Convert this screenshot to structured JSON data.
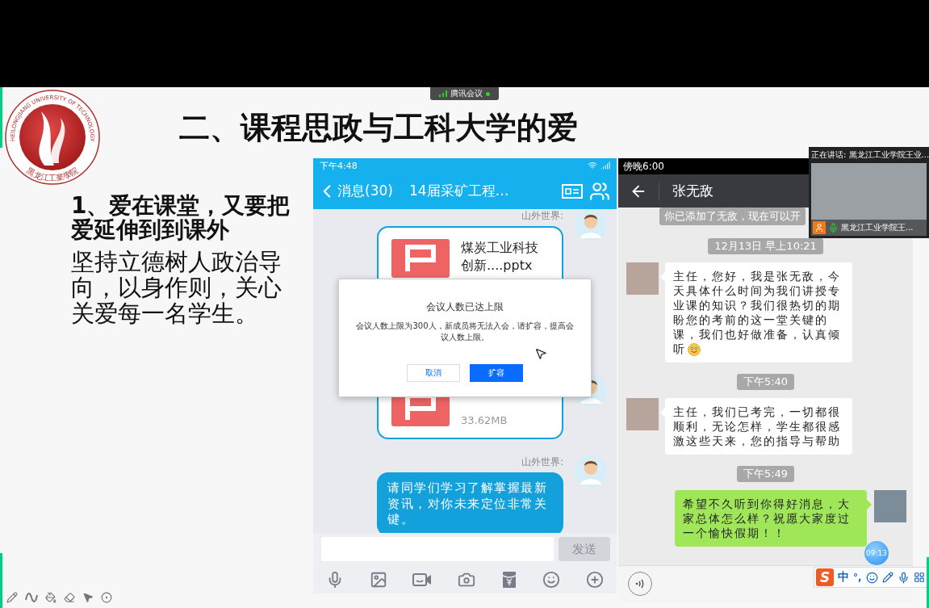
{
  "meeting_badge": {
    "label": "腾讯会议"
  },
  "slide": {
    "logo": {
      "ring_text": "HEILONGJIANG UNIVERSITY OF TECHNOLOGY",
      "seal_text": "黑龙江工業學院"
    },
    "title": "二、课程思政与工科大学的爱",
    "heading": "1、爱在课堂，又要把爱延伸到到课外",
    "body": "坚持立德树人政治导向，以身作则，关心关爱每一名学生。"
  },
  "qq_chat": {
    "status_time": "下午4:48",
    "back_label": "消息(30)",
    "title": "14届采矿工程…",
    "messages": [
      {
        "kind": "file",
        "sender": "山外世界:",
        "name": "煤炭工业科技创新....pptx"
      },
      {
        "kind": "file",
        "size": "33.62MB"
      },
      {
        "kind": "text",
        "sender": "山外世界:",
        "text": "请同学们学习了解掌握最新资讯，对你未来定位非常关键。"
      }
    ],
    "send_button": {
      "label": "发送",
      "disabled": true
    },
    "dialog": {
      "title": "会议人数已达上限",
      "message": "会议人数上限为300人，新成员将无法入会，请扩容，提高会议人数上限。",
      "buttons": [
        {
          "label": "取消",
          "primary": false
        },
        {
          "label": "扩容",
          "primary": true
        }
      ]
    }
  },
  "wechat_chat": {
    "status_time": "傍晚6:00",
    "title": "张无敌",
    "items": [
      {
        "kind": "system",
        "text": "你已添加了无敌，现在可以开"
      },
      {
        "kind": "time",
        "text": "12月13日 早上10:21"
      },
      {
        "kind": "incoming",
        "text": "主任，您好，我是张无敌，今天具体什么时间为我们讲授专业课的知识？我们很热切的期盼您的考前的这一堂关键的课，我们也好做准备，认真倾听",
        "emoji": true
      },
      {
        "kind": "time",
        "text": "下午5:40"
      },
      {
        "kind": "incoming",
        "text": "主任，我们已考完，一切都很顺利，无论怎样，学生都很感激这些天来，您的指导与帮助",
        "emoji": false
      },
      {
        "kind": "time",
        "text": "下午5:49"
      },
      {
        "kind": "outgoing",
        "text": "希望不久听到你得好消息，大家总体怎么样？祝愿大家度过一个愉快假期！！",
        "emoji": false
      }
    ],
    "floating_badge": "09:13"
  },
  "speaker_video": {
    "speaking": "正在讲话: 黑龙江工业学院王业...",
    "name": "黑龙江工业学院王..."
  },
  "ime_toolbar": {
    "logo": "S",
    "mode": "中",
    "punctuation": "°,"
  }
}
